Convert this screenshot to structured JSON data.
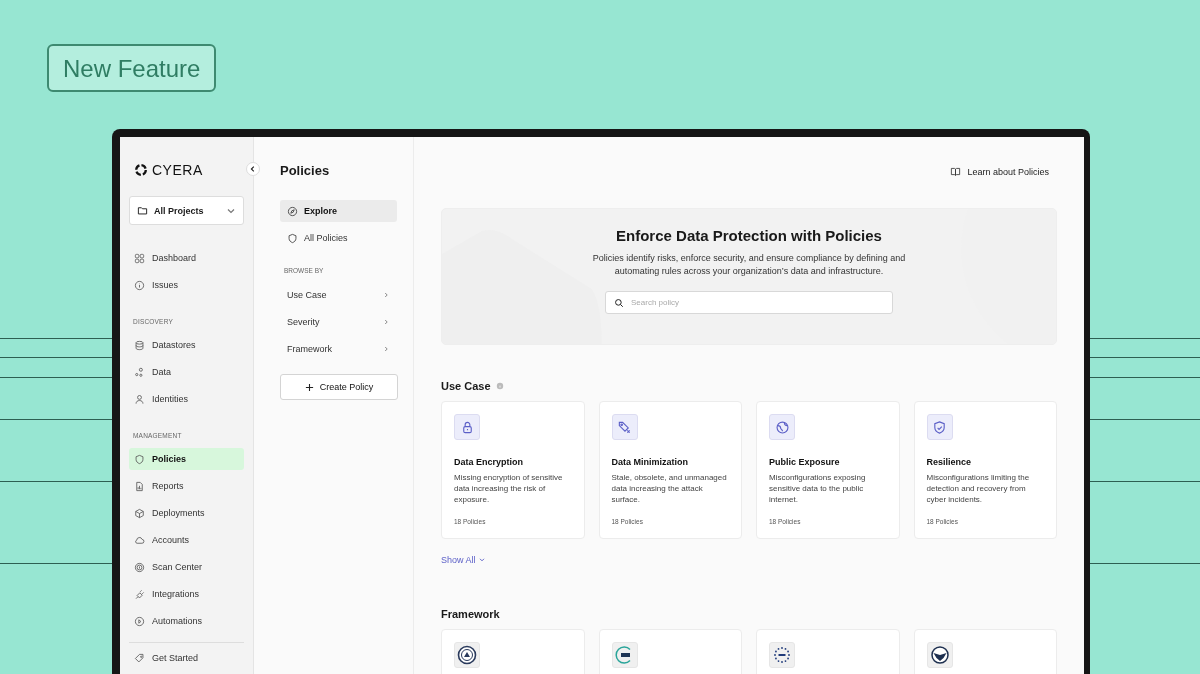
{
  "badge": {
    "label": "New Feature"
  },
  "sidebar": {
    "logo": "CYERA",
    "project": "All Projects",
    "sections": [
      {
        "items": [
          {
            "label": "Dashboard",
            "selected": false
          },
          {
            "label": "Issues",
            "selected": false
          }
        ]
      },
      {
        "title": "DISCOVERY",
        "items": [
          {
            "label": "Datastores",
            "selected": false
          },
          {
            "label": "Data",
            "selected": false
          },
          {
            "label": "Identities",
            "selected": false
          }
        ]
      },
      {
        "title": "MANAGEMENT",
        "items": [
          {
            "label": "Policies",
            "selected": true
          },
          {
            "label": "Reports",
            "selected": false
          },
          {
            "label": "Deployments",
            "selected": false
          },
          {
            "label": "Accounts",
            "selected": false
          },
          {
            "label": "Scan Center",
            "selected": false
          },
          {
            "label": "Integrations",
            "selected": false
          },
          {
            "label": "Automations",
            "selected": false
          }
        ]
      }
    ],
    "footer_items": [
      {
        "label": "Get Started",
        "selected": false
      }
    ]
  },
  "subnav": {
    "title": "Policies",
    "items": [
      {
        "label": "Explore",
        "selected": true
      },
      {
        "label": "All Policies",
        "selected": false
      }
    ],
    "browse_title": "BROWSE BY",
    "browse": [
      {
        "label": "Use Case"
      },
      {
        "label": "Severity"
      },
      {
        "label": "Framework"
      }
    ],
    "create_button": "Create Policy"
  },
  "header": {
    "link": "Learn about Policies"
  },
  "hero": {
    "title": "Enforce Data Protection with Policies",
    "text": "Policies identify risks, enforce security, and ensure compliance by defining and automating rules across your organization’s data and infrastructure.",
    "search": {
      "placeholder": "Search policy"
    }
  },
  "use_case": {
    "title": "Use Case",
    "cards": [
      {
        "title": "Data Encryption",
        "text": "Missing encryption of sensitive data increasing the risk of exposure.",
        "count": "18 Policies"
      },
      {
        "title": "Data Minimization",
        "text": "Stale, obsolete, and unmanaged data increasing the attack surface.",
        "count": "18 Policies"
      },
      {
        "title": "Public Exposure",
        "text": "Misconfigurations exposing sensitive data to the public internet.",
        "count": "18 Policies"
      },
      {
        "title": "Resilience",
        "text": "Misconfigurations limiting the detection and recovery from cyber incidents.",
        "count": "18 Policies"
      }
    ],
    "show_all": "Show All"
  },
  "framework": {
    "title": "Framework",
    "cards": [
      {
        "kind": "seal"
      },
      {
        "kind": "ring-logo"
      },
      {
        "kind": "star-circle"
      },
      {
        "kind": "eagle-seal"
      }
    ]
  }
}
